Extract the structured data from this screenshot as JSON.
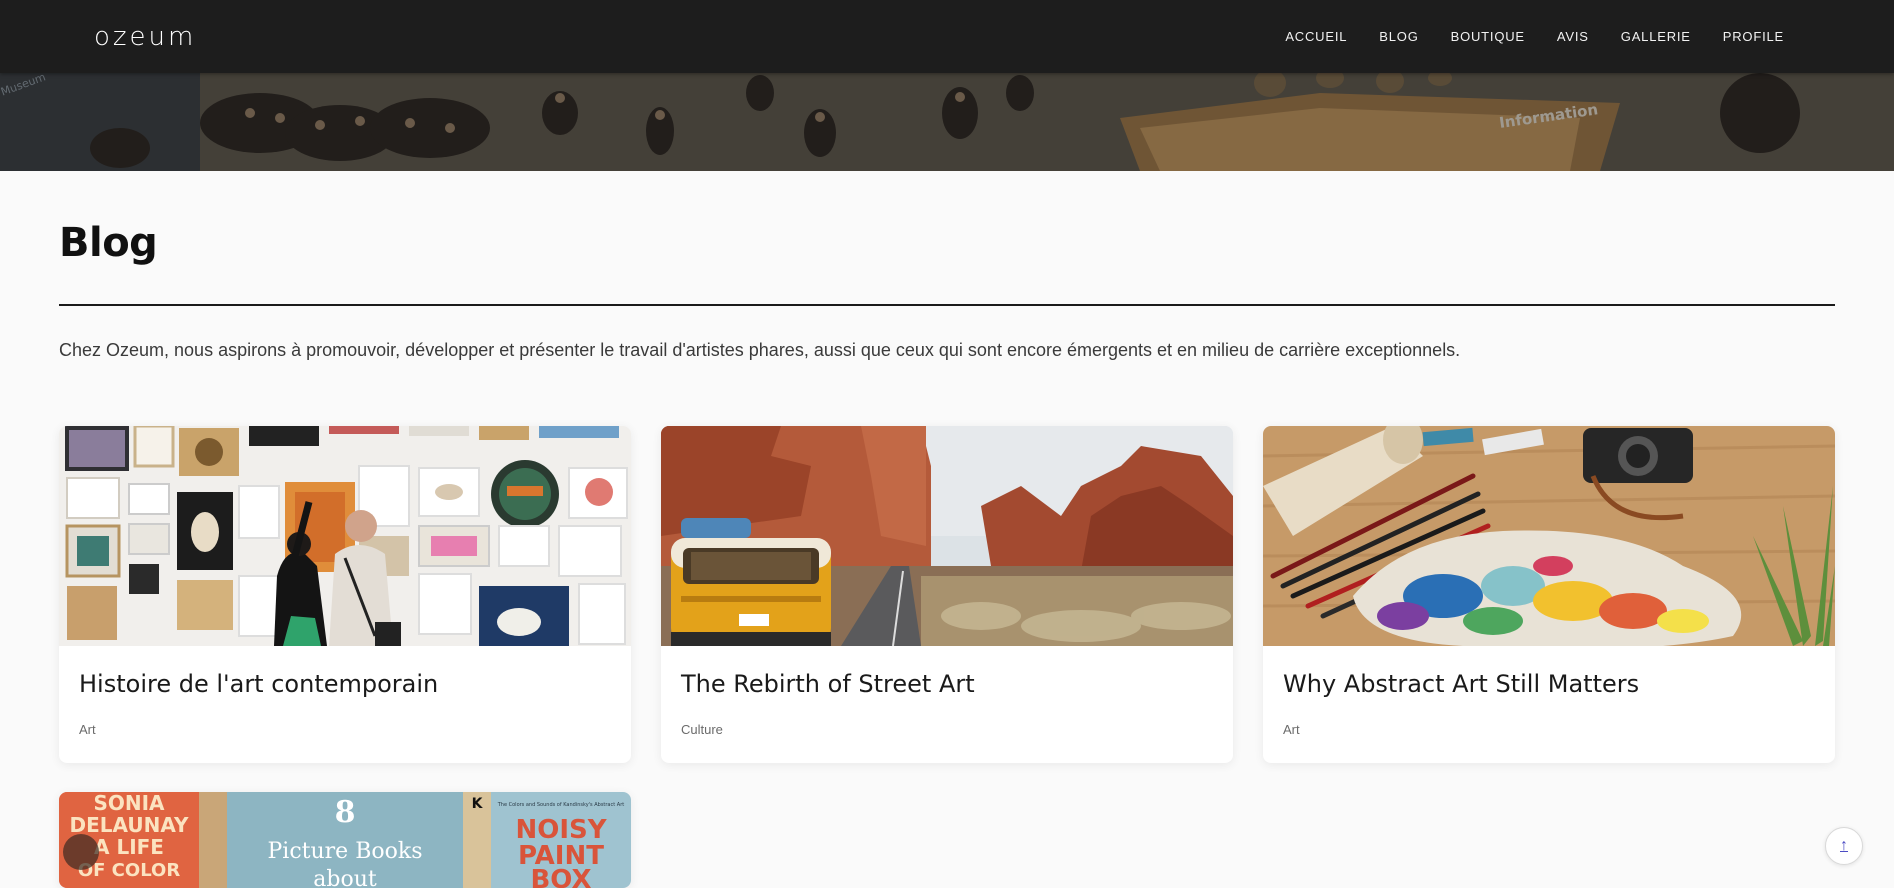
{
  "navbar": {
    "brand": "ozeum",
    "links": [
      "ACCUEIL",
      "BLOG",
      "BOUTIQUE",
      "AVIS",
      "GALLERIE",
      "PROFILE"
    ]
  },
  "hero": {
    "sign_text": "Information",
    "wall_text": "Museum"
  },
  "page": {
    "title": "Blog",
    "intro": "Chez Ozeum, nous aspirons à promouvoir, développer et présenter le travail d'artistes phares, aussi que ceux qui sont encore émergents et en milieu de carrière exceptionnels."
  },
  "posts": [
    {
      "title": "Histoire de l'art contemporain",
      "category": "Art"
    },
    {
      "title": "The Rebirth of Street Art",
      "category": "Culture"
    },
    {
      "title": "Why Abstract Art Still Matters",
      "category": "Art"
    },
    {
      "title": "",
      "category": ""
    }
  ],
  "book_cover": {
    "left_title": [
      "SONIA",
      "DELAUNAY",
      "A LIFE",
      "OF COLOR"
    ],
    "center_number": "8",
    "center_lines": [
      "Picture Books",
      "about"
    ],
    "right_small": "The Colors and Sounds of Kandinsky's Abstract Art",
    "right_title": [
      "NOISY",
      "PAINT",
      "BOX"
    ],
    "right_letter": "K"
  },
  "scroll_button": {
    "label": "↑"
  },
  "colors": {
    "navbar_bg": "#1d1d1d",
    "page_bg": "#fafafa",
    "text_dark": "#1a1a1a",
    "category_gray": "#6b6b6b"
  }
}
